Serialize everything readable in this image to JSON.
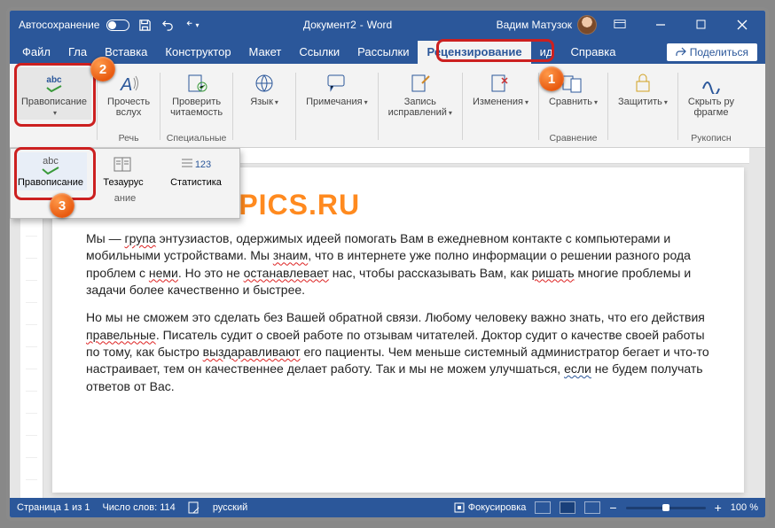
{
  "title": {
    "autosave": "Автосохранение",
    "doc": "Документ2",
    "app": "Word",
    "user": "Вадим Матузок"
  },
  "tabs": {
    "file": "Файл",
    "home": "Гла",
    "insert": "Вставка",
    "design": "Конструктор",
    "layout": "Макет",
    "references": "Ссылки",
    "mailings": "Рассылки",
    "review": "Рецензирование",
    "view": "ид",
    "help": "Справка",
    "share": "Поделиться"
  },
  "ribbon": {
    "spelling": "Правописание",
    "readaloud": "Прочесть\nвслух",
    "accessibility": "Проверить\nчитаемость",
    "language": "Язык",
    "comments": "Примечания",
    "tracking": "Запись\nисправлений",
    "changes": "Изменения",
    "compare": "Сравнить",
    "protect": "Защитить",
    "ink": "Скрыть ру\nфрагме",
    "grp_speech": "Речь",
    "grp_special": "Специальные",
    "grp_compare": "Сравнение",
    "grp_ink": "Рукописн",
    "abc": "abc"
  },
  "dropdown": {
    "spelling": "Правописание",
    "thesaurus": "Тезаурус",
    "stats": "Статистика",
    "group": "ание",
    "abc": "abc",
    "n123": "123"
  },
  "document": {
    "logo": "LUMPICS.RU",
    "p1a": "Мы — ",
    "p1w1": "група",
    "p1b": " энтузиастов, одержимых идеей помогать Вам в ежедневном контакте с компьютерами и мобильными устройствами. Мы ",
    "p1w2": "знаим",
    "p1c": ", что в интернете уже полно информации о решении разного рода проблем с ",
    "p1w3": "неми",
    "p1d": ". Но это не ",
    "p1w4": "останавлевает",
    "p1e": " нас, чтобы рассказывать Вам, как ",
    "p1w5": "ришать",
    "p1f": " многие проблемы и задачи более качественно и быстрее.",
    "p2a": "Но мы не сможем это сделать без Вашей обратной связи. Любому человеку важно знать, что его действия ",
    "p2w1": "правельные",
    "p2b": ". Писатель судит о своей работе по отзывам читателей. Доктор судит о качестве своей работы по тому, как быстро ",
    "p2w2": "выздаравливают",
    "p2c": " его пациенты. Чем меньше системный администратор бегает и что-то настраивает, тем он качественнее делает работу. Так и мы не можем улучшаться, ",
    "p2w3": "если",
    "p2d": " не будем получать ответов от Вас."
  },
  "status": {
    "page": "Страница 1 из 1",
    "words": "Число слов: 114",
    "lang": "русский",
    "focus": "Фокусировка",
    "zoom": "100 %",
    "minus": "−",
    "plus": "+"
  },
  "badges": {
    "b1": "1",
    "b2": "2",
    "b3": "3"
  }
}
